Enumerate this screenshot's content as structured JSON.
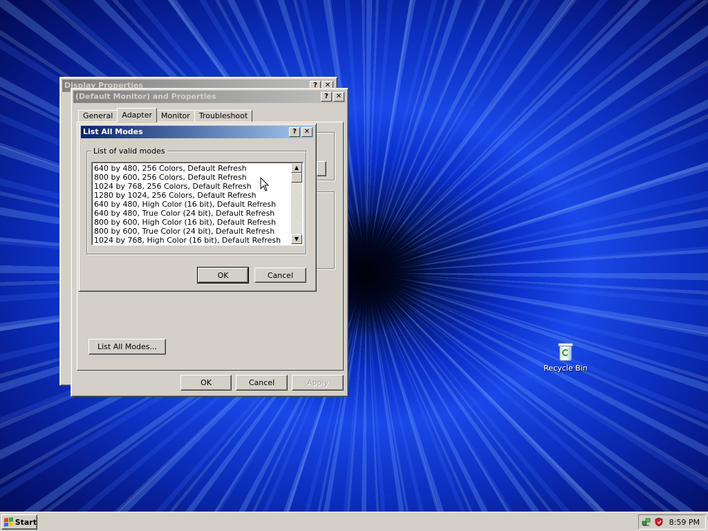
{
  "desktop": {
    "recycle_bin_label": "Recycle Bin"
  },
  "display_properties": {
    "title": "Display Properties",
    "help_btn": "?",
    "close_btn": "✕"
  },
  "monitor_properties": {
    "title": "(Default Monitor) and  Properties",
    "help_btn": "?",
    "close_btn": "✕",
    "tabs": [
      {
        "label": "General",
        "selected": false
      },
      {
        "label": "Adapter",
        "selected": true
      },
      {
        "label": "Monitor",
        "selected": false
      },
      {
        "label": "Troubleshoot",
        "selected": false
      }
    ],
    "list_all_modes_button": "List All Modes...",
    "ok_button": "OK",
    "cancel_button": "Cancel",
    "apply_button": "Apply"
  },
  "list_all_modes_dialog": {
    "title": "List All Modes",
    "help_btn": "?",
    "close_btn": "✕",
    "group_label": "List of valid modes",
    "modes": [
      "640 by 480, 256 Colors, Default Refresh",
      "800 by 600, 256 Colors, Default Refresh",
      "1024 by 768, 256 Colors, Default Refresh",
      "1280 by 1024, 256 Colors, Default Refresh",
      "640 by 480, High Color (16 bit), Default Refresh",
      "640 by 480, True Color (24 bit), Default Refresh",
      "800 by 600, High Color (16 bit), Default Refresh",
      "800 by 600, True Color (24 bit), Default Refresh",
      "1024 by 768, High Color (16 bit), Default Refresh"
    ],
    "ok_button": "OK",
    "cancel_button": "Cancel"
  },
  "taskbar": {
    "start_label": "Start",
    "clock": "8:59 PM",
    "tray_icons": [
      "network-icon",
      "security-shield-icon"
    ]
  },
  "colors": {
    "active_title": "#0a246a",
    "inactive_title": "#808080",
    "face": "#d4d0c8"
  }
}
